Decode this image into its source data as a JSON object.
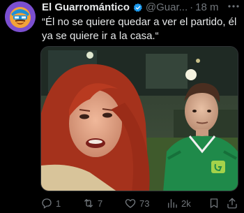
{
  "tweet": {
    "author_name": "El Guarromántico",
    "handle": "@Guar...",
    "separator": "·",
    "time": "18 m",
    "text": "“Él no se quiere quedar a ver el partido, él ya se quiere ir a la casa.“"
  },
  "actions": {
    "replies": "1",
    "retweets": "7",
    "likes": "73",
    "views": "2k"
  },
  "colors": {
    "background": "#000000",
    "verified": "#1d9bf0",
    "muted": "#71767b",
    "text": "#e7e9ea"
  },
  "icons": [
    "avatar-logo",
    "verified-badge-icon",
    "more-icon",
    "reply-icon",
    "retweet-icon",
    "like-icon",
    "views-icon",
    "bookmark-icon",
    "share-icon"
  ]
}
